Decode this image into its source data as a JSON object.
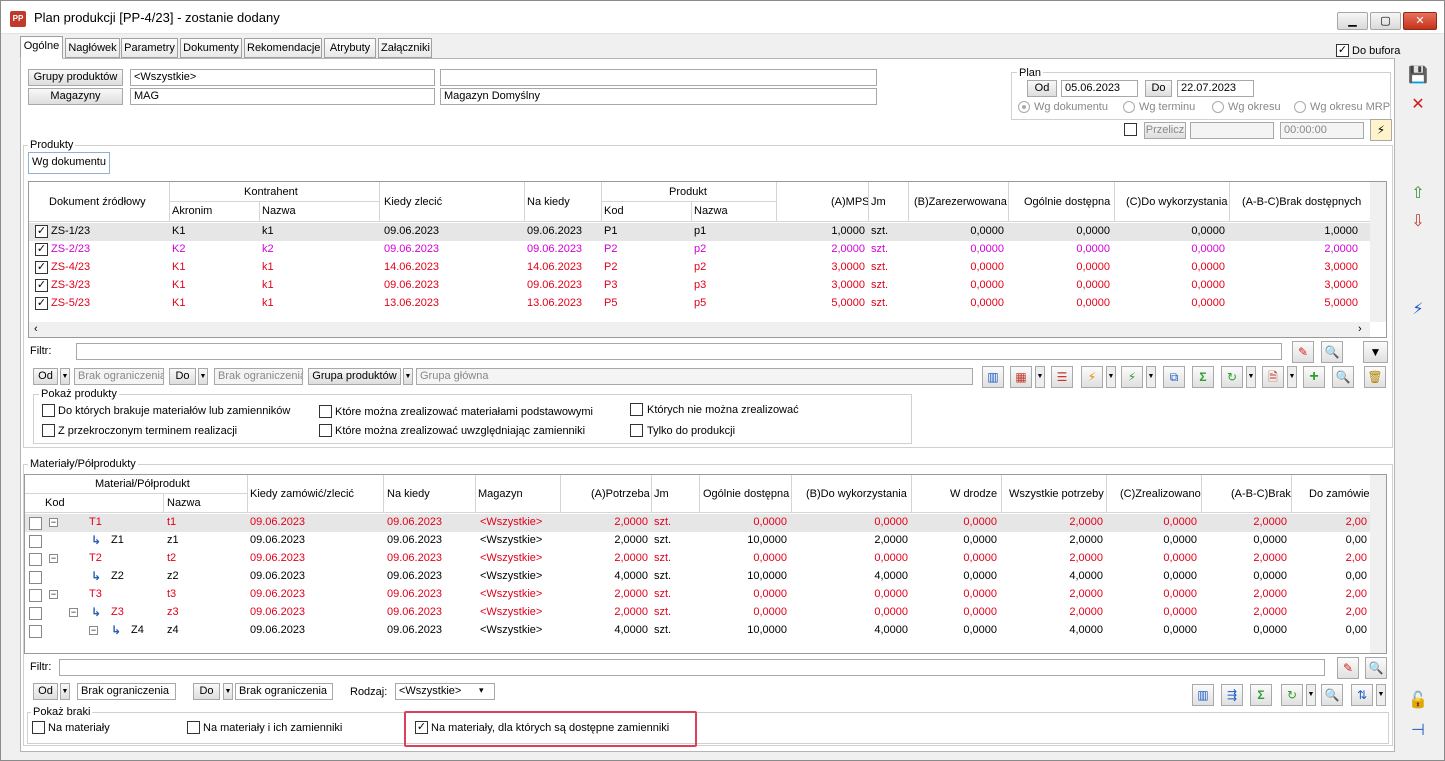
{
  "window": {
    "title": "Plan produkcji [PP-4/23] - zostanie dodany",
    "icon": "PP"
  },
  "tabs": [
    "Ogólne",
    "Nagłówek",
    "Parametry",
    "Dokumenty",
    "Rekomendacje",
    "Atrybuty",
    "Załączniki"
  ],
  "do_bufora": {
    "label": "Do bufora",
    "checked": true
  },
  "filters": {
    "grupy_btn": "Grupy produktów",
    "grupy_value": "<Wszystkie>",
    "grupy_desc": "",
    "magazyny_btn": "Magazyny",
    "magazyny_value": "MAG",
    "magazyny_desc": "Magazyn Domyślny"
  },
  "plan": {
    "title": "Plan",
    "od_btn": "Od",
    "od_value": "05.06.2023",
    "do_btn": "Do",
    "do_value": "22.07.2023",
    "radios": [
      "Wg dokumentu",
      "Wg terminu",
      "Wg okresu",
      "Wg okresu MRP"
    ],
    "przelicz": "Przelicz",
    "time": "00:00:00"
  },
  "produkty": {
    "title": "Produkty",
    "subtab": "Wg dokumentu",
    "headers": {
      "doc": "Dokument źródłowy",
      "kontrahent": "Kontrahent",
      "akronim": "Akronim",
      "nazwa": "Nazwa",
      "kiedy": "Kiedy zlecić",
      "na_kiedy": "Na kiedy",
      "produkt": "Produkt",
      "kod": "Kod",
      "pnazwa": "Nazwa",
      "mps": "(A)MPS",
      "jm": "Jm",
      "zar": "(B)Zarezerwowana",
      "ogol": "Ogólnie dostępna",
      "dowyk": "(C)Do wykorzystania",
      "brak": "(A-B-C)Brak dostępnych"
    },
    "rows": [
      {
        "doc": "ZS-1/23",
        "ak": "K1",
        "naz": "k1",
        "kiedy": "09.06.2023",
        "na": "09.06.2023",
        "kod": "P1",
        "pn": "p1",
        "mps": "1,0000",
        "jm": "szt.",
        "zar": "0,0000",
        "ogol": "0,0000",
        "dowyk": "0,0000",
        "brak": "1,0000",
        "color": "black"
      },
      {
        "doc": "ZS-2/23",
        "ak": "K2",
        "naz": "k2",
        "kiedy": "09.06.2023",
        "na": "09.06.2023",
        "kod": "P2",
        "pn": "p2",
        "mps": "2,0000",
        "jm": "szt.",
        "zar": "0,0000",
        "ogol": "0,0000",
        "dowyk": "0,0000",
        "brak": "2,0000",
        "color": "mag"
      },
      {
        "doc": "ZS-4/23",
        "ak": "K1",
        "naz": "k1",
        "kiedy": "14.06.2023",
        "na": "14.06.2023",
        "kod": "P2",
        "pn": "p2",
        "mps": "3,0000",
        "jm": "szt.",
        "zar": "0,0000",
        "ogol": "0,0000",
        "dowyk": "0,0000",
        "brak": "3,0000",
        "color": "red"
      },
      {
        "doc": "ZS-3/23",
        "ak": "K1",
        "naz": "k1",
        "kiedy": "09.06.2023",
        "na": "09.06.2023",
        "kod": "P3",
        "pn": "p3",
        "mps": "3,0000",
        "jm": "szt.",
        "zar": "0,0000",
        "ogol": "0,0000",
        "dowyk": "0,0000",
        "brak": "3,0000",
        "color": "red"
      },
      {
        "doc": "ZS-5/23",
        "ak": "K1",
        "naz": "k1",
        "kiedy": "13.06.2023",
        "na": "13.06.2023",
        "kod": "P5",
        "pn": "p5",
        "mps": "5,0000",
        "jm": "szt.",
        "zar": "0,0000",
        "ogol": "0,0000",
        "dowyk": "0,0000",
        "brak": "5,0000",
        "color": "red"
      }
    ],
    "filtr_label": "Filtr:",
    "od": "Od",
    "od_placeholder": "Brak ograniczenia",
    "do": "Do",
    "do_placeholder": "Brak ograniczenia",
    "grupa_btn": "Grupa produktów",
    "grupa_value": "Grupa główna",
    "pokaz_title": "Pokaż produkty",
    "pokaz": [
      "Do których brakuje materiałów lub zamienników",
      "Z przekroczonym terminem realizacji",
      "Które można zrealizować materiałami podstawowymi",
      "Które można zrealizować uwzględniając zamienniki",
      "Których nie można zrealizować",
      "Tylko do produkcji"
    ]
  },
  "materialy": {
    "title": "Materiały/Półprodukty",
    "headers": {
      "mp": "Materiał/Półprodukt",
      "kod": "Kod",
      "nazwa": "Nazwa",
      "kiedy": "Kiedy zamówić/zlecić",
      "na": "Na kiedy",
      "mag": "Magazyn",
      "potr": "(A)Potrzeba",
      "jm": "Jm",
      "ogol": "Ogólnie dostępna",
      "dowyk": "(B)Do wykorzystania",
      "wdr": "W drodze",
      "wszyst": "Wszystkie potrzeby",
      "zreal": "(C)Zrealizowano",
      "brak": "(A-B-C)Brak",
      "dozam": "Do zamówie"
    },
    "rows": [
      {
        "kod": "T1",
        "naz": "t1",
        "kiedy": "09.06.2023",
        "na": "09.06.2023",
        "mag": "<Wszystkie>",
        "potr": "2,0000",
        "jm": "szt.",
        "ogol": "0,0000",
        "dowyk": "0,0000",
        "wdr": "0,0000",
        "wsz": "2,0000",
        "zr": "0,0000",
        "brak": "2,0000",
        "dz": "2,00",
        "color": "red",
        "lvl": 0,
        "box": true,
        "sel": true
      },
      {
        "kod": "Z1",
        "naz": "z1",
        "kiedy": "09.06.2023",
        "na": "09.06.2023",
        "mag": "<Wszystkie>",
        "potr": "2,0000",
        "jm": "szt.",
        "ogol": "10,0000",
        "dowyk": "2,0000",
        "wdr": "0,0000",
        "wsz": "2,0000",
        "zr": "0,0000",
        "brak": "0,0000",
        "dz": "0,00",
        "color": "black",
        "lvl": 1,
        "box": false,
        "sel": false
      },
      {
        "kod": "T2",
        "naz": "t2",
        "kiedy": "09.06.2023",
        "na": "09.06.2023",
        "mag": "<Wszystkie>",
        "potr": "2,0000",
        "jm": "szt.",
        "ogol": "0,0000",
        "dowyk": "0,0000",
        "wdr": "0,0000",
        "wsz": "2,0000",
        "zr": "0,0000",
        "brak": "2,0000",
        "dz": "2,00",
        "color": "red",
        "lvl": 0,
        "box": true,
        "sel": false
      },
      {
        "kod": "Z2",
        "naz": "z2",
        "kiedy": "09.06.2023",
        "na": "09.06.2023",
        "mag": "<Wszystkie>",
        "potr": "4,0000",
        "jm": "szt.",
        "ogol": "10,0000",
        "dowyk": "4,0000",
        "wdr": "0,0000",
        "wsz": "4,0000",
        "zr": "0,0000",
        "brak": "0,0000",
        "dz": "0,00",
        "color": "black",
        "lvl": 1,
        "box": false,
        "sel": false
      },
      {
        "kod": "T3",
        "naz": "t3",
        "kiedy": "09.06.2023",
        "na": "09.06.2023",
        "mag": "<Wszystkie>",
        "potr": "2,0000",
        "jm": "szt.",
        "ogol": "0,0000",
        "dowyk": "0,0000",
        "wdr": "0,0000",
        "wsz": "2,0000",
        "zr": "0,0000",
        "brak": "2,0000",
        "dz": "2,00",
        "color": "red",
        "lvl": 0,
        "box": true,
        "sel": false
      },
      {
        "kod": "Z3",
        "naz": "z3",
        "kiedy": "09.06.2023",
        "na": "09.06.2023",
        "mag": "<Wszystkie>",
        "potr": "2,0000",
        "jm": "szt.",
        "ogol": "0,0000",
        "dowyk": "0,0000",
        "wdr": "0,0000",
        "wsz": "2,0000",
        "zr": "0,0000",
        "brak": "2,0000",
        "dz": "2,00",
        "color": "red",
        "lvl": 1,
        "box": true,
        "sel": false
      },
      {
        "kod": "Z4",
        "naz": "z4",
        "kiedy": "09.06.2023",
        "na": "09.06.2023",
        "mag": "<Wszystkie>",
        "potr": "4,0000",
        "jm": "szt.",
        "ogol": "10,0000",
        "dowyk": "4,0000",
        "wdr": "0,0000",
        "wsz": "4,0000",
        "zr": "0,0000",
        "brak": "0,0000",
        "dz": "0,00",
        "color": "black",
        "lvl": 2,
        "box": true,
        "sel": false
      }
    ],
    "filtr_label": "Filtr:",
    "od": "Od",
    "od_value": "Brak ograniczenia",
    "do": "Do",
    "do_value": "Brak ograniczenia",
    "rodzaj_label": "Rodzaj:",
    "rodzaj_value": "<Wszystkie>",
    "braki_title": "Pokaż braki",
    "braki": [
      "Na materiały",
      "Na materiały i ich zamienniki",
      "Na materiały, dla których są dostępne zamienniki"
    ]
  }
}
